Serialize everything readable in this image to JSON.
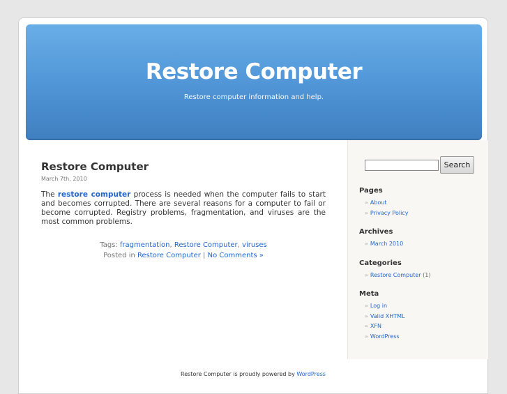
{
  "header": {
    "title": "Restore Computer",
    "description": "Restore computer information and help."
  },
  "post": {
    "title": "Restore Computer",
    "date": "March 7th, 2010",
    "body_before": "The ",
    "body_link": "restore computer",
    "body_after": " process is needed when the computer fails to start and becomes corrupted.  There are several reasons for a computer to fail or become corrupted.  Registry problems, fragmentation, and viruses are the most common problems.",
    "tags_label": "Tags: ",
    "tags": [
      "fragmentation",
      "Restore Computer",
      "viruses"
    ],
    "posted_in_label": "Posted in ",
    "category": "Restore Computer",
    "comments": "No Comments »",
    "separator": " | "
  },
  "sidebar": {
    "search_button": "Search",
    "search_value": "",
    "pages_heading": "Pages",
    "pages": [
      "About",
      "Privacy Policy"
    ],
    "archives_heading": "Archives",
    "archives": [
      "March 2010"
    ],
    "categories_heading": "Categories",
    "categories": [
      {
        "name": "Restore Computer",
        "count": "(1)"
      }
    ],
    "meta_heading": "Meta",
    "meta": [
      "Log in",
      "Valid XHTML",
      "XFN",
      "WordPress"
    ],
    "bullet": "»"
  },
  "footer": {
    "text": "Restore Computer is proudly powered by ",
    "link": "WordPress"
  }
}
